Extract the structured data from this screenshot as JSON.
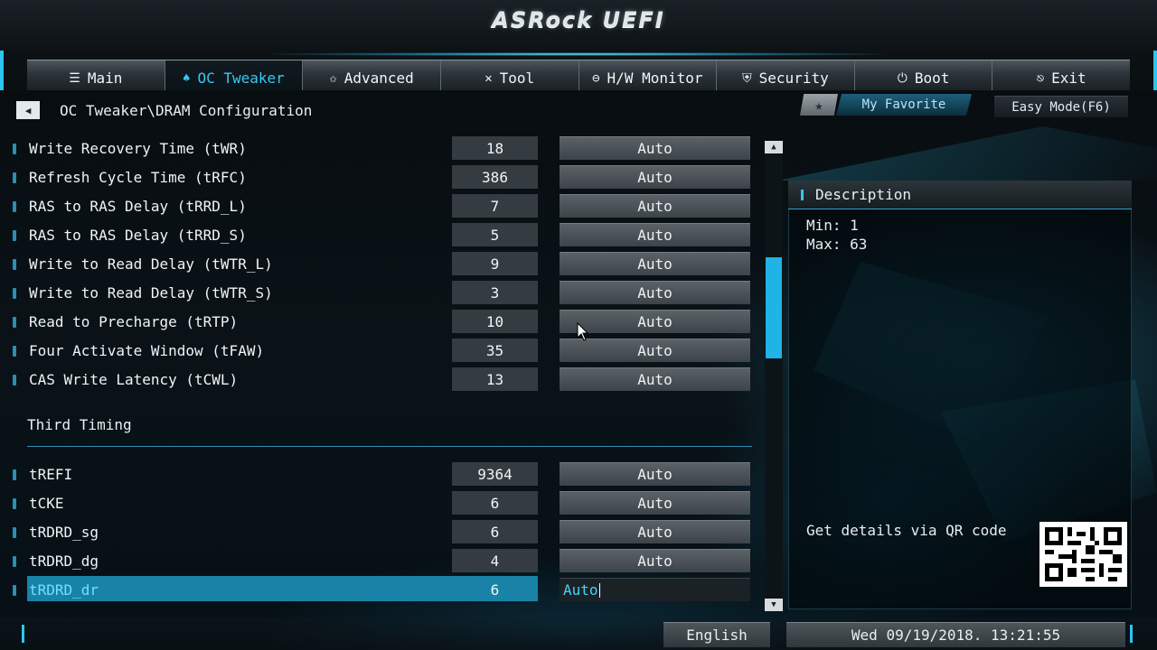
{
  "brand": "ASRock UEFI",
  "tabs": [
    {
      "label": "Main",
      "icon": "list-icon",
      "glyph": "☰"
    },
    {
      "label": "OC Tweaker",
      "icon": "rocket-icon",
      "glyph": "♠"
    },
    {
      "label": "Advanced",
      "icon": "star-icon",
      "glyph": "✩"
    },
    {
      "label": "Tool",
      "icon": "tools-icon",
      "glyph": "✕"
    },
    {
      "label": "H/W Monitor",
      "icon": "monitor-icon",
      "glyph": "⊖"
    },
    {
      "label": "Security",
      "icon": "shield-icon",
      "glyph": "⛨"
    },
    {
      "label": "Boot",
      "icon": "power-icon",
      "glyph": "⏻"
    },
    {
      "label": "Exit",
      "icon": "exit-icon",
      "glyph": "⎋"
    }
  ],
  "breadcrumb": "OC Tweaker\\DRAM Configuration",
  "my_favorite": "My Favorite",
  "easy_mode": "Easy Mode(F6)",
  "rows_top": [
    {
      "label": "Write Recovery Time (tWR)",
      "value": "18",
      "option": "Auto"
    },
    {
      "label": "Refresh Cycle Time (tRFC)",
      "value": "386",
      "option": "Auto"
    },
    {
      "label": "RAS to RAS Delay (tRRD_L)",
      "value": "7",
      "option": "Auto"
    },
    {
      "label": "RAS to RAS Delay (tRRD_S)",
      "value": "5",
      "option": "Auto"
    },
    {
      "label": "Write to Read Delay (tWTR_L)",
      "value": "9",
      "option": "Auto"
    },
    {
      "label": "Write to Read Delay (tWTR_S)",
      "value": "3",
      "option": "Auto"
    },
    {
      "label": "Read to Precharge (tRTP)",
      "value": "10",
      "option": "Auto"
    },
    {
      "label": "Four Activate Window (tFAW)",
      "value": "35",
      "option": "Auto"
    },
    {
      "label": "CAS Write Latency (tCWL)",
      "value": "13",
      "option": "Auto"
    }
  ],
  "section_title": "Third Timing",
  "rows_bottom": [
    {
      "label": "tREFI",
      "value": "9364",
      "option": "Auto"
    },
    {
      "label": "tCKE",
      "value": "6",
      "option": "Auto"
    },
    {
      "label": "tRDRD_sg",
      "value": "6",
      "option": "Auto"
    },
    {
      "label": "tRDRD_dg",
      "value": "4",
      "option": "Auto"
    },
    {
      "label": "tRDRD_dr",
      "value": "6",
      "option": "Auto",
      "selected": true
    }
  ],
  "description": {
    "title": "Description",
    "min": "Min: 1",
    "max": "Max: 63",
    "qr_text": "Get details via QR code"
  },
  "footer": {
    "language": "English",
    "datetime": "Wed 09/19/2018. 13:21:55"
  },
  "colors": {
    "accent": "#1fb3e6",
    "selection": "#1883a6",
    "active_tab_text": "#37c8f4"
  }
}
